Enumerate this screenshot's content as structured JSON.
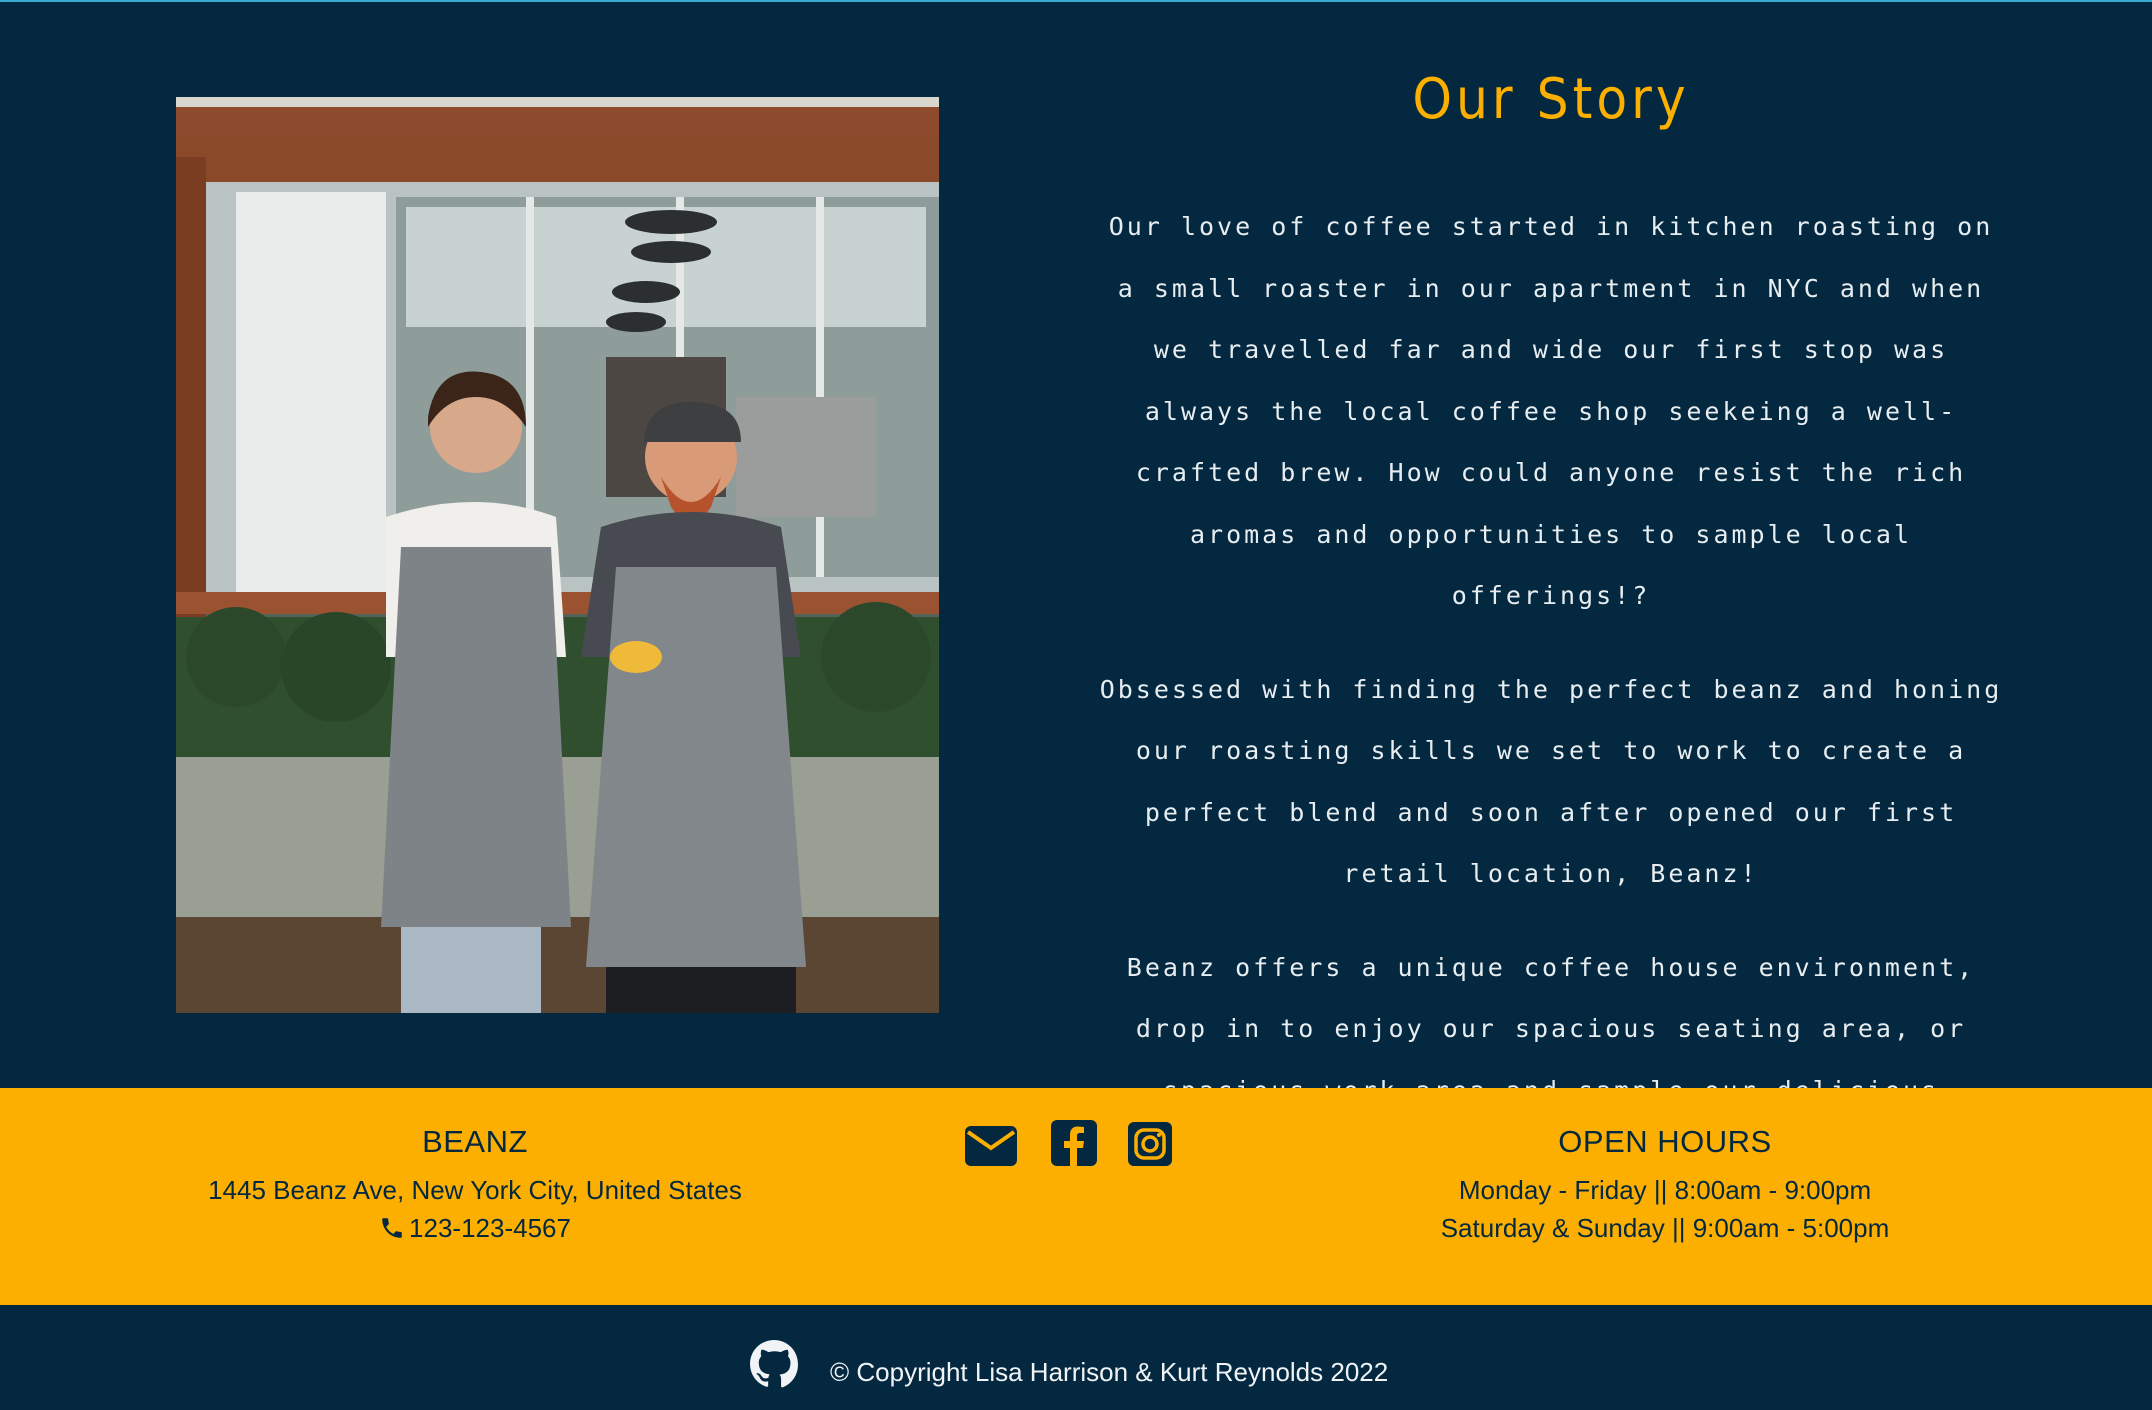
{
  "story": {
    "title": "Our Story",
    "paragraphs": [
      "Our love of coffee started in kitchen roasting on a small roaster in our apartment in NYC and when we travelled far and wide our first stop was always the local coffee shop seekeing a well-crafted brew. How could anyone resist the rich aromas and opportunities to sample local offerings!?",
      "Obsessed with finding the perfect beanz and honing our roasting skills we set to work to create a perfect blend and soon after opened our first retail location, Beanz!",
      "Beanz offers a unique coffee house environment, drop in to enjoy our spacious seating area, or spacious work area and sample our delicious varieties of coffee, from classic coffee to our selection of house made speciality beverages."
    ],
    "photo_icon": "baristas-photo"
  },
  "footer": {
    "brand": {
      "name": "BEANZ",
      "address": "1445 Beanz Ave, New York City, United States",
      "phone": "123-123-4567",
      "phone_icon": "phone-icon"
    },
    "social_icons": [
      "envelope-icon",
      "facebook-icon",
      "instagram-icon"
    ],
    "hours": {
      "title": "OPEN HOURS",
      "weekday": "Monday - Friday || 8:00am - 9:00pm",
      "weekend": "Saturday & Sunday || 9:00am - 5:00pm"
    }
  },
  "copyright": {
    "github_icon": "github-icon",
    "text": "© Copyright Lisa Harrison & Kurt Reynolds 2022"
  },
  "colors": {
    "navy": "#03283f",
    "gold": "#fcaf00",
    "text_light": "#e7edf1",
    "accent_line": "#3aa9d4"
  }
}
